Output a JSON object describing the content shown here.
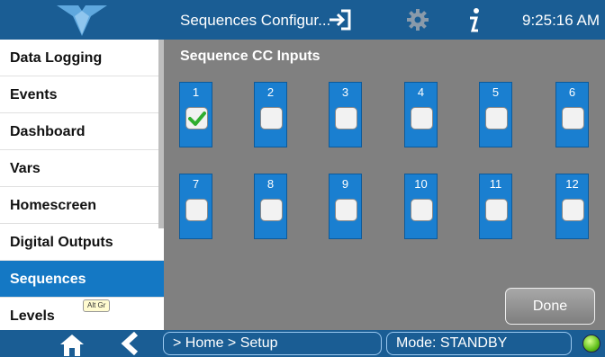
{
  "header": {
    "title": "Sequences Configur...",
    "time": "9:25:16 AM",
    "icons": [
      "logo-icon",
      "logout-icon",
      "gear-icon",
      "info-icon"
    ]
  },
  "sidebar": {
    "items": [
      {
        "label": "Data Logging",
        "active": false
      },
      {
        "label": "Events",
        "active": false
      },
      {
        "label": "Dashboard",
        "active": false
      },
      {
        "label": "Vars",
        "active": false
      },
      {
        "label": "Homescreen",
        "active": false
      },
      {
        "label": "Digital Outputs",
        "active": false
      },
      {
        "label": "Sequences",
        "active": true
      },
      {
        "label": "Levels",
        "active": false
      }
    ],
    "altgr_label": "Alt Gr"
  },
  "main": {
    "title": "Sequence CC Inputs",
    "inputs": [
      {
        "number": "1",
        "checked": true
      },
      {
        "number": "2",
        "checked": false
      },
      {
        "number": "3",
        "checked": false
      },
      {
        "number": "4",
        "checked": false
      },
      {
        "number": "5",
        "checked": false
      },
      {
        "number": "6",
        "checked": false
      },
      {
        "number": "7",
        "checked": false
      },
      {
        "number": "8",
        "checked": false
      },
      {
        "number": "9",
        "checked": false
      },
      {
        "number": "10",
        "checked": false
      },
      {
        "number": "11",
        "checked": false
      },
      {
        "number": "12",
        "checked": false
      }
    ],
    "done_label": "Done"
  },
  "footer": {
    "breadcrumb": "> Home > Setup",
    "mode": "Mode: STANDBY",
    "icons": [
      "home-icon",
      "back-icon",
      "status-led-icon"
    ]
  },
  "colors": {
    "header_bg": "#1a5d94",
    "accent": "#1478c4",
    "panel_bg": "#808080",
    "cc_bg": "#1a7fd0",
    "check": "#2fae2f",
    "led": "#5fbf1a"
  }
}
